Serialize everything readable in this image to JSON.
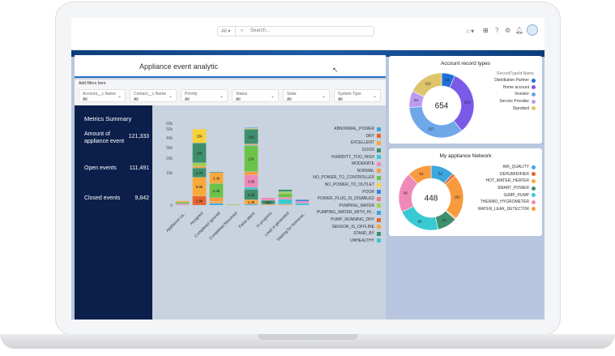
{
  "header": {
    "search_scope": "All",
    "search_placeholder": "Search..."
  },
  "dashboard": {
    "title": "Appliance event analytic",
    "filters_label": "Add filters here",
    "filters": [
      {
        "name": "Account__c.Name",
        "value": "All"
      },
      {
        "name": "Contact__c.Name",
        "value": "All"
      },
      {
        "name": "Priority",
        "value": "All"
      },
      {
        "name": "Status",
        "value": "All"
      },
      {
        "name": "State",
        "value": "All"
      },
      {
        "name": "System Type",
        "value": "All"
      }
    ],
    "metrics": {
      "title": "Metrics Summary",
      "items": [
        {
          "label": "Amount of appliance event",
          "value": "121,333"
        },
        {
          "label": "Open events",
          "value": "111,491"
        },
        {
          "label": "Closed events",
          "value": "9,842"
        }
      ]
    }
  },
  "chart_data": [
    {
      "type": "bar",
      "stacked": true,
      "y_ticks": [
        "0",
        "10k",
        "20k",
        "30k",
        "40k",
        "50k",
        "60k"
      ],
      "y_tick_values": [
        0,
        10000,
        20000,
        30000,
        40000,
        50000,
        60000
      ],
      "categories": [
        "Appliance ca...",
        "Assigned",
        "Completed Ignored",
        "Completed Resolved",
        "False alarm",
        "In progress",
        "Lead is generated",
        "Waiting for Homeow..."
      ],
      "legend": [
        {
          "name": "ABNORMAL_POWER",
          "color": "#3ba7de"
        },
        {
          "name": "DRY",
          "color": "#e8642c"
        },
        {
          "name": "EXCELLENT",
          "color": "#f9a93a"
        },
        {
          "name": "GOOD",
          "color": "#3f8f6e"
        },
        {
          "name": "HUMIDITY_TOO_HIGH",
          "color": "#3ac9d3"
        },
        {
          "name": "MODERATE",
          "color": "#ef8ab8"
        },
        {
          "name": "NORMAL",
          "color": "#f89a3e"
        },
        {
          "name": "NO_POWER_TO_CONTROLLER",
          "color": "#6cc24a"
        },
        {
          "name": "NO_POWER_TO_OUTLET",
          "color": "#f8d23a"
        },
        {
          "name": "POOR",
          "color": "#3b82e0"
        },
        {
          "name": "POWER_PLUG_IS_DISABLED",
          "color": "#ee7a8a"
        },
        {
          "name": "PUMPING_WATER",
          "color": "#a4cc55"
        },
        {
          "name": "PUMPING_WATER_WITH_HI...",
          "color": "#3ba7de"
        },
        {
          "name": "PUMP_RUNNING_DRY",
          "color": "#e8642c"
        },
        {
          "name": "SENSOR_IS_OFFLINE",
          "color": "#f9a93a"
        },
        {
          "name": "STAND_BY",
          "color": "#3f8f6e"
        },
        {
          "name": "UNHEALTHY",
          "color": "#3ac9d3"
        }
      ],
      "stacks": [
        [
          {
            "v": 400,
            "c": "#ef8ab8"
          },
          {
            "v": 500,
            "c": "#6cc24a"
          },
          {
            "v": 400,
            "c": "#f9a93a"
          }
        ],
        [
          {
            "v": 2800,
            "c": "#e8642c",
            "label": "2.8k"
          },
          {
            "v": 5800,
            "c": "#f9a93a",
            "label": "5.8k"
          },
          {
            "v": 4700,
            "c": "#3f8f6e",
            "label": "4.7k"
          },
          {
            "v": 1000,
            "c": "#f89a3e"
          },
          {
            "v": 2500,
            "c": "#a4cc55"
          },
          {
            "v": 18000,
            "c": "#3f8f6e",
            "label": "18k"
          },
          {
            "v": 15000,
            "c": "#f8d23a",
            "label": "15k"
          }
        ],
        [
          {
            "v": 600,
            "c": "#3ba7de"
          },
          {
            "v": 500,
            "c": "#f9a93a"
          },
          {
            "v": 1200,
            "c": "#f89a3e"
          },
          {
            "v": 4400,
            "c": "#6cc24a",
            "label": "4.4k"
          },
          {
            "v": 3400,
            "c": "#f9a93a",
            "label": "3.4k"
          },
          {
            "v": 500,
            "c": "#3f8f6e"
          }
        ],
        [
          {
            "v": 300,
            "c": "#a4cc55"
          }
        ],
        [
          {
            "v": 300,
            "c": "#3ba7de"
          },
          {
            "v": 1400,
            "c": "#f9a93a",
            "label": "1.4k"
          },
          {
            "v": 3200,
            "c": "#3f8f6e",
            "label": "3.2k"
          },
          {
            "v": 600,
            "c": "#3ac9d3"
          },
          {
            "v": 3800,
            "c": "#ef8ab8",
            "label": "3.8k"
          },
          {
            "v": 1500,
            "c": "#f89a3e"
          },
          {
            "v": 21000,
            "c": "#6cc24a",
            "label": "21k"
          },
          {
            "v": 800,
            "c": "#3ac9d3"
          },
          {
            "v": 1200,
            "c": "#f89a3e"
          },
          {
            "v": 16000,
            "c": "#3f8f6e",
            "label": "16k"
          },
          {
            "v": 1600,
            "c": "#f8d23a"
          },
          {
            "v": 1000,
            "c": "#3ba7de"
          }
        ],
        [
          {
            "v": 300,
            "c": "#f9a93a"
          },
          {
            "v": 1200,
            "c": "#3f8f6e",
            "label": "980"
          },
          {
            "v": 800,
            "c": "#ef8ab8"
          }
        ],
        [
          {
            "v": 300,
            "c": "#f89a3e"
          },
          {
            "v": 1500,
            "c": "#3ac9d3"
          },
          {
            "v": 600,
            "c": "#ef8ab8"
          },
          {
            "v": 1200,
            "c": "#6cc24a"
          },
          {
            "v": 600,
            "c": "#a4cc55"
          },
          {
            "v": 600,
            "c": "#3f8f6e"
          }
        ],
        [
          {
            "v": 600,
            "c": "#3ac9d3"
          },
          {
            "v": 600,
            "c": "#ef8ab8"
          },
          {
            "v": 500,
            "c": "#3b82e0"
          }
        ]
      ]
    },
    {
      "type": "pie",
      "donut": true,
      "title": "Account record types",
      "legend_title": "RecordTypeId.Name",
      "total": "654",
      "slices": [
        {
          "name": "Distribution Partner",
          "value": 44,
          "color": "#1f6fd6"
        },
        {
          "name": "Home account",
          "value": 213,
          "color": "#7b5ae8"
        },
        {
          "name": "Investor",
          "value": 227,
          "color": "#6fa8e8"
        },
        {
          "name": "Service Provider",
          "value": 54,
          "color": "#b99cf0"
        },
        {
          "name": "Standard",
          "value": 116,
          "color": "#e0c46c"
        }
      ]
    },
    {
      "type": "pie",
      "donut": true,
      "title": "My appliance Network",
      "total": "448",
      "legend": [
        {
          "name": "AIR_QUALITY",
          "color": "#3ba7de"
        },
        {
          "name": "DEHUMIDIFIER",
          "color": "#e8642c"
        },
        {
          "name": "HOT_WATER_HEATER",
          "color": "#f9a93a"
        },
        {
          "name": "SMART_POWER",
          "color": "#3f8f6e"
        },
        {
          "name": "SUMP_PUMP",
          "color": "#3ac9d3"
        },
        {
          "name": "THERMO_HYGROMETER",
          "color": "#ef8ab8"
        },
        {
          "name": "WATER_LEAK_DETECTOR",
          "color": "#f89a3e"
        }
      ],
      "slices": [
        {
          "name": "AIR_QUALITY",
          "value": 52,
          "color": "#3ba7de",
          "label": "52"
        },
        {
          "name": "DEHUMIDIFIER",
          "value": 7,
          "color": "#e8642c"
        },
        {
          "name": "WATER_LEAK_DETECTOR",
          "value": 102,
          "color": "#f89a3e",
          "label": "102"
        },
        {
          "name": "HOT_WATER_HEATER",
          "value": 3,
          "color": "#f9a93a"
        },
        {
          "name": "SMART_POWER",
          "value": 44,
          "color": "#3f8f6e",
          "label": "44"
        },
        {
          "name": "SUMP_PUMP",
          "value": 96,
          "color": "#3ac9d3",
          "label": "96"
        },
        {
          "name": "THERMO_HYGROMETER",
          "value": 90,
          "color": "#ef8ab8",
          "label": "90"
        },
        {
          "name": "WATER_LEAK_DETECTOR",
          "value": 54,
          "color": "#f89a3e",
          "label": "54"
        }
      ]
    }
  ]
}
